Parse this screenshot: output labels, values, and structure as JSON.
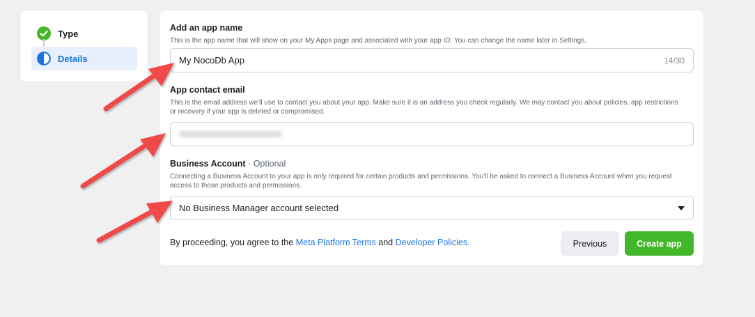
{
  "steps": [
    {
      "label": "Type",
      "state": "complete",
      "icon": "check-circle-icon"
    },
    {
      "label": "Details",
      "state": "current",
      "icon": "half-circle-icon"
    }
  ],
  "form": {
    "app_name": {
      "title": "Add an app name",
      "description": "This is the app name that will show on your My Apps page and associated with your app ID. You can change the name later in Settings.",
      "value": "My NocoDb App",
      "counter": "14/30"
    },
    "contact_email": {
      "title": "App contact email",
      "description": "This is the email address we'll use to contact you about your app. Make sure it is an address you check regularly. We may contact you about policies, app restrictions or recovery if your app is deleted or compromised."
    },
    "business_account": {
      "title": "Business Account",
      "optional": "· Optional",
      "description": "Connecting a Business Account to your app is only required for certain products and permissions. You'll be asked to connect a Business Account when you request access to those products and permissions.",
      "selected": "No Business Manager account selected"
    }
  },
  "footer": {
    "prefix": "By proceeding, you agree to the",
    "terms_link": "Meta Platform Terms",
    "and": "and",
    "policies_link": "Developer Policies."
  },
  "buttons": {
    "previous": "Previous",
    "create": "Create app"
  },
  "colors": {
    "accent": "#1b74e4",
    "create_button": "#42b72a",
    "annotation_arrow": "#f0484a"
  }
}
